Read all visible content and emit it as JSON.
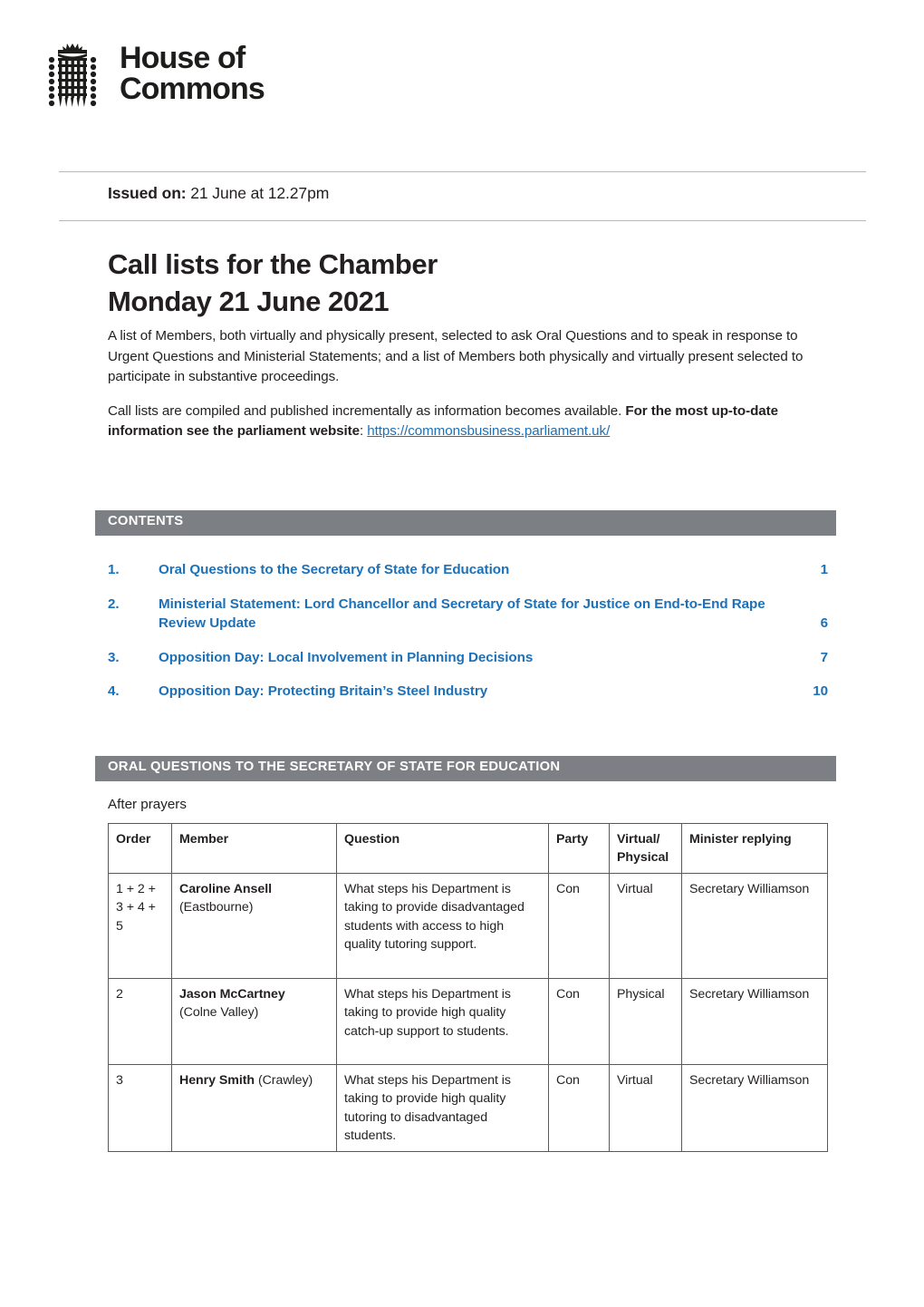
{
  "masthead": {
    "logo_icon": "portcullis-icon",
    "wordmark": "House of\nCommons"
  },
  "header": {
    "issued_label": "Issued on:",
    "issued_value": " 21 June at 12.27pm",
    "title": "Call lists for the Chamber\nMonday 21 June 2021",
    "intro_paragraph_1": "A list of Members, both virtually and physically present, selected to ask Oral Questions and to speak in response to Urgent Questions and Ministerial Statements; and a list of Members both physically and virtually present selected to participate in substantive proceedings.",
    "intro_paragraph_2_plain": "Call lists are compiled and published incrementally as information becomes available. ",
    "intro_paragraph_2_bold": "For the most up-to-date information see the parliament website",
    "intro_paragraph_2_colon": ": ",
    "intro_link": "https://commonsbusiness.parliament.uk/"
  },
  "contents": {
    "bar_label": "CONTENTS",
    "items": [
      {
        "number": "1.",
        "label": "Oral Questions to the Secretary of State for Education",
        "page": "1"
      },
      {
        "number": "2.",
        "label": "Ministerial Statement: Lord Chancellor and Secretary of State for Justice on End-to-End Rape Review Update",
        "page": "6"
      },
      {
        "number": "3.",
        "label": "Opposition Day: Local Involvement in Planning Decisions",
        "page": "7"
      },
      {
        "number": "4.",
        "label": "Opposition Day: Protecting Britain’s Steel Industry",
        "page": "10"
      }
    ]
  },
  "section": {
    "bar_label": "ORAL QUESTIONS TO THE SECRETARY OF STATE FOR EDUCATION",
    "note": "After prayers",
    "table": {
      "headers": {
        "order": "Order",
        "member": "Member",
        "question": "Question",
        "party": "Party",
        "virtual_physical": "Virtual/\nPhysical",
        "minister": "Minister replying"
      },
      "rows": [
        {
          "order": "1 + 2 + 3 + 4 + 5",
          "member_name": "Caroline Ansell",
          "member_constituency": "(Eastbourne)",
          "member_inline": false,
          "question": "What steps his Department is taking to provide disadvan­taged students with access to high quality tutoring support.",
          "party": "Con",
          "virtual_physical": "Virtual",
          "minister": "Secretary Williamson"
        },
        {
          "order": "2",
          "member_name": "Jason McCartney",
          "member_constituency": "(Colne Valley)",
          "member_inline": false,
          "question": "What steps his Department is taking to provide high quality catch-up support to students.",
          "party": "Con",
          "virtual_physical": "Physical",
          "minister": "Secretary Williamson"
        },
        {
          "order": "3",
          "member_name": "Henry Smith",
          "member_constituency": "(Crawley)",
          "member_inline": true,
          "question": "What steps his Department is taking to provide high quality tutoring to disadvan­taged students.",
          "party": "Con",
          "virtual_physical": "Virtual",
          "minister": "Secretary Williamson"
        }
      ]
    }
  },
  "colors": {
    "link_blue": "#1c70b8",
    "bar_grey": "#7c7f83",
    "text_black": "#231f20",
    "rule_grey": "#b6b8ba"
  }
}
